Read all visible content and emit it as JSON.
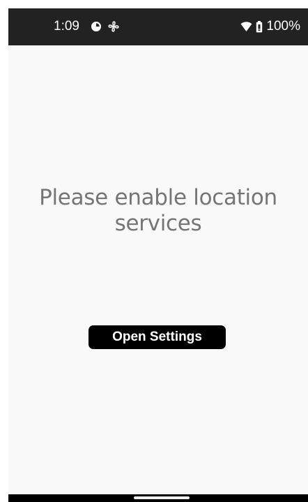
{
  "status_bar": {
    "time": "1:09",
    "left_icons": [
      "data-saver-icon",
      "fan-icon"
    ],
    "right_icons": [
      "wifi-icon",
      "battery-icon"
    ],
    "battery_percent": "100%"
  },
  "main": {
    "message": "Please enable location services",
    "open_settings_label": "Open Settings"
  },
  "colors": {
    "status_bar_bg": "#222222",
    "screen_bg": "#f9f9f9",
    "message_text": "#757575",
    "button_bg": "#000000",
    "button_text": "#ffffff",
    "nav_bar_bg": "#000000"
  }
}
